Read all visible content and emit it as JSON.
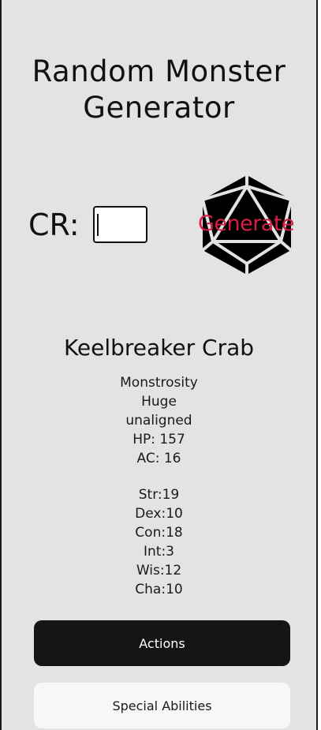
{
  "app": {
    "title": "Random Monster Generator"
  },
  "cr": {
    "label": "CR:",
    "value": ""
  },
  "generate": {
    "label": "Generate",
    "icon": "d20-icon",
    "accent": "#d71e46"
  },
  "monster": {
    "name": "Keelbreaker Crab",
    "type": "Monstrosity",
    "size": "Huge",
    "alignment": "unaligned",
    "hp": "HP: 157",
    "ac": "AC: 16",
    "str": "Str:19",
    "dex": "Dex:10",
    "con": "Con:18",
    "int": "Int:3",
    "wis": "Wis:12",
    "cha": "Cha:10"
  },
  "buttons": {
    "actions": "Actions",
    "special": "Special Abilities"
  }
}
